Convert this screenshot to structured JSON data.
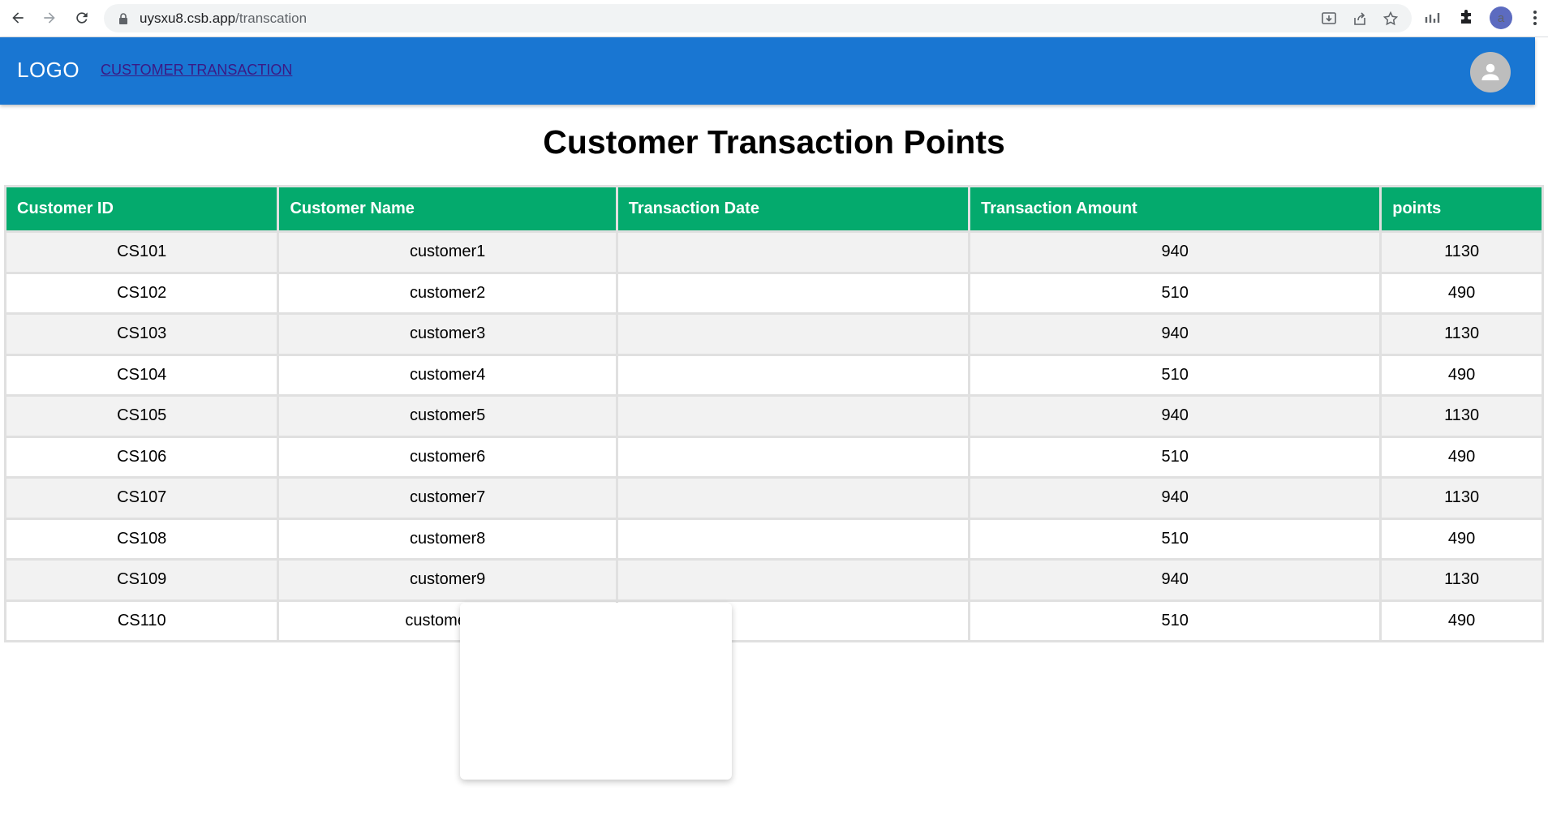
{
  "browser": {
    "url_host": "uysxu8.csb.app",
    "url_path": "/transcation",
    "profile_initial": "a"
  },
  "app_bar": {
    "logo": "LOGO",
    "nav_link": "CUSTOMER TRANSACTION",
    "color": "#1976d2"
  },
  "page": {
    "title": "Customer Transaction Points"
  },
  "table": {
    "header_color": "#04aa6d",
    "columns": [
      "Customer ID",
      "Customer Name",
      "Transaction Date",
      "Transaction Amount",
      "points"
    ],
    "rows": [
      {
        "id": "CS101",
        "name": "customer1",
        "date": "",
        "amount": "940",
        "points": "1130"
      },
      {
        "id": "CS102",
        "name": "customer2",
        "date": "",
        "amount": "510",
        "points": "490"
      },
      {
        "id": "CS103",
        "name": "customer3",
        "date": "",
        "amount": "940",
        "points": "1130"
      },
      {
        "id": "CS104",
        "name": "customer4",
        "date": "",
        "amount": "510",
        "points": "490"
      },
      {
        "id": "CS105",
        "name": "customer5",
        "date": "",
        "amount": "940",
        "points": "1130"
      },
      {
        "id": "CS106",
        "name": "customer6",
        "date": "",
        "amount": "510",
        "points": "490"
      },
      {
        "id": "CS107",
        "name": "customer7",
        "date": "",
        "amount": "940",
        "points": "1130"
      },
      {
        "id": "CS108",
        "name": "customer8",
        "date": "",
        "amount": "510",
        "points": "490"
      },
      {
        "id": "CS109",
        "name": "customer9",
        "date": "",
        "amount": "940",
        "points": "1130"
      },
      {
        "id": "CS110",
        "name": "customer10",
        "date": "",
        "amount": "510",
        "points": "490"
      }
    ]
  }
}
